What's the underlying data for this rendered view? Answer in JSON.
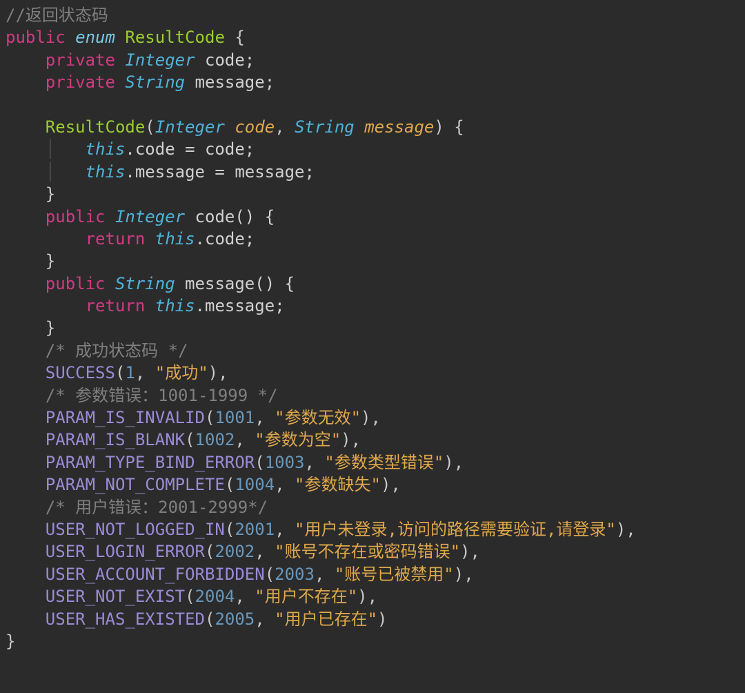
{
  "tokens": {
    "l1_comment": "//返回状态码",
    "l2_public": "public",
    "l2_enum": "enum",
    "l2_name": "ResultCode",
    "l2_open": " {",
    "l3_private": "private",
    "l3_type": "Integer",
    "l3_name": " code;",
    "l4_private": "private",
    "l4_type": "String",
    "l4_name": " message;",
    "l6_ctor": "ResultCode",
    "l6_lp": "(",
    "l6_t1": "Integer",
    "l6_p1": "code",
    "l6_comma": ", ",
    "l6_t2": "String",
    "l6_p2": "message",
    "l6_rp_open": ") {",
    "l7_this": "this",
    "l7_rest": ".code = code;",
    "l8_this": "this",
    "l8_rest": ".message = message;",
    "l9_close": "}",
    "l10_public": "public",
    "l10_type": "Integer",
    "l10_name": " code() {",
    "l11_return": "return",
    "l11_this": "this",
    "l11_rest": ".code;",
    "l12_close": "}",
    "l13_public": "public",
    "l13_type": "String",
    "l13_name": " message() {",
    "l14_return": "return",
    "l14_this": "this",
    "l14_rest": ".message;",
    "l15_close": "}",
    "l16_comment": "/* 成功状态码 */",
    "l17_name": "SUCCESS",
    "l17_lp": "(",
    "l17_num": "1",
    "l17_c": ", ",
    "l17_str": "\"成功\"",
    "l17_rp": "),",
    "l18_comment": "/* 参数错误：1001-1999 */",
    "l19_name": "PARAM_IS_INVALID",
    "l19_lp": "(",
    "l19_num": "1001",
    "l19_c": ", ",
    "l19_str": "\"参数无效\"",
    "l19_rp": "),",
    "l20_name": "PARAM_IS_BLANK",
    "l20_lp": "(",
    "l20_num": "1002",
    "l20_c": ", ",
    "l20_str": "\"参数为空\"",
    "l20_rp": "),",
    "l21_name": "PARAM_TYPE_BIND_ERROR",
    "l21_lp": "(",
    "l21_num": "1003",
    "l21_c": ", ",
    "l21_str": "\"参数类型错误\"",
    "l21_rp": "),",
    "l22_name": "PARAM_NOT_COMPLETE",
    "l22_lp": "(",
    "l22_num": "1004",
    "l22_c": ", ",
    "l22_str": "\"参数缺失\"",
    "l22_rp": "),",
    "l23_comment": "/* 用户错误：2001-2999*/",
    "l24_name": "USER_NOT_LOGGED_IN",
    "l24_lp": "(",
    "l24_num": "2001",
    "l24_c": ", ",
    "l24_str": "\"用户未登录,访问的路径需要验证,请登录\"",
    "l24_rp": "),",
    "l25_name": "USER_LOGIN_ERROR",
    "l25_lp": "(",
    "l25_num": "2002",
    "l25_c": ", ",
    "l25_str": "\"账号不存在或密码错误\"",
    "l25_rp": "),",
    "l26_name": "USER_ACCOUNT_FORBIDDEN",
    "l26_lp": "(",
    "l26_num": "2003",
    "l26_c": ", ",
    "l26_str": "\"账号已被禁用\"",
    "l26_rp": "),",
    "l27_name": "USER_NOT_EXIST",
    "l27_lp": "(",
    "l27_num": "2004",
    "l27_c": ", ",
    "l27_str": "\"用户不存在\"",
    "l27_rp": "),",
    "l28_name": "USER_HAS_EXISTED",
    "l28_lp": "(",
    "l28_num": "2005",
    "l28_c": ", ",
    "l28_str": "\"用户已存在\"",
    "l28_rp": ")",
    "l29_close": "}"
  }
}
